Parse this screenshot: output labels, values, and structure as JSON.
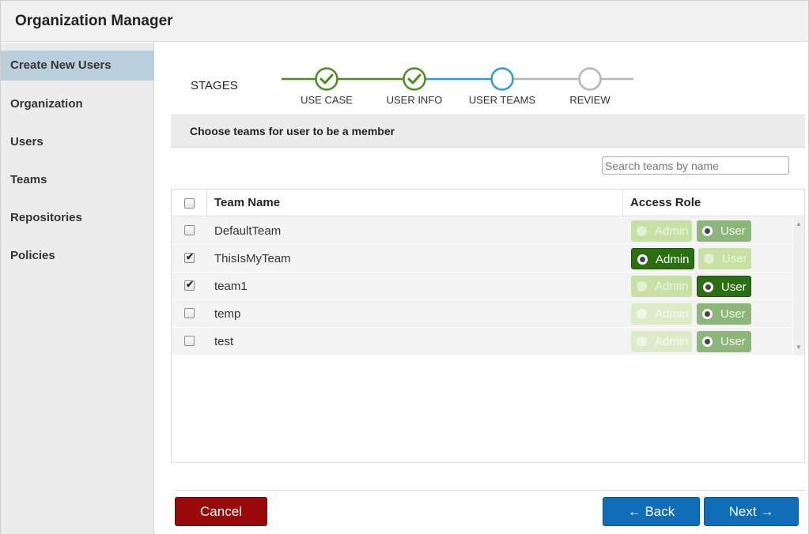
{
  "app": {
    "title": "Organization Manager"
  },
  "sidebar": {
    "items": [
      {
        "label": "Create New Users",
        "active": true
      },
      {
        "label": "Organization"
      },
      {
        "label": "Users"
      },
      {
        "label": "Teams"
      },
      {
        "label": "Repositories"
      },
      {
        "label": "Policies"
      }
    ]
  },
  "stages": {
    "label": "STAGES",
    "steps": [
      {
        "label": "USE CASE",
        "state": "done"
      },
      {
        "label": "USER INFO",
        "state": "done"
      },
      {
        "label": "USER TEAMS",
        "state": "current"
      },
      {
        "label": "REVIEW",
        "state": "pending"
      }
    ],
    "colors": {
      "done": "#4e8a1f",
      "current": "#2f9ad6",
      "pending": "#b5b5b5"
    }
  },
  "section": {
    "title": "Choose teams for user to be a member"
  },
  "search": {
    "placeholder": "Search teams by name",
    "value": ""
  },
  "table": {
    "headers": {
      "name": "Team Name",
      "role": "Access Role"
    },
    "role_labels": {
      "admin": "Admin",
      "user": "User"
    },
    "rows": [
      {
        "name": "DefaultTeam",
        "checked": false,
        "role": "user"
      },
      {
        "name": "ThisIsMyTeam",
        "checked": true,
        "role": "admin"
      },
      {
        "name": "team1",
        "checked": true,
        "role": "user"
      },
      {
        "name": "temp",
        "checked": false,
        "role": "user"
      },
      {
        "name": "test",
        "checked": false,
        "role": "user"
      }
    ]
  },
  "footer": {
    "cancel_label": "Cancel",
    "back_label": "← Back",
    "next_label": "Next →"
  },
  "colors": {
    "cancel": "#9b0a0a",
    "primary": "#0f6db8",
    "role_selected": "#2a6f12",
    "sidebar_active": "#b9cfdb"
  }
}
